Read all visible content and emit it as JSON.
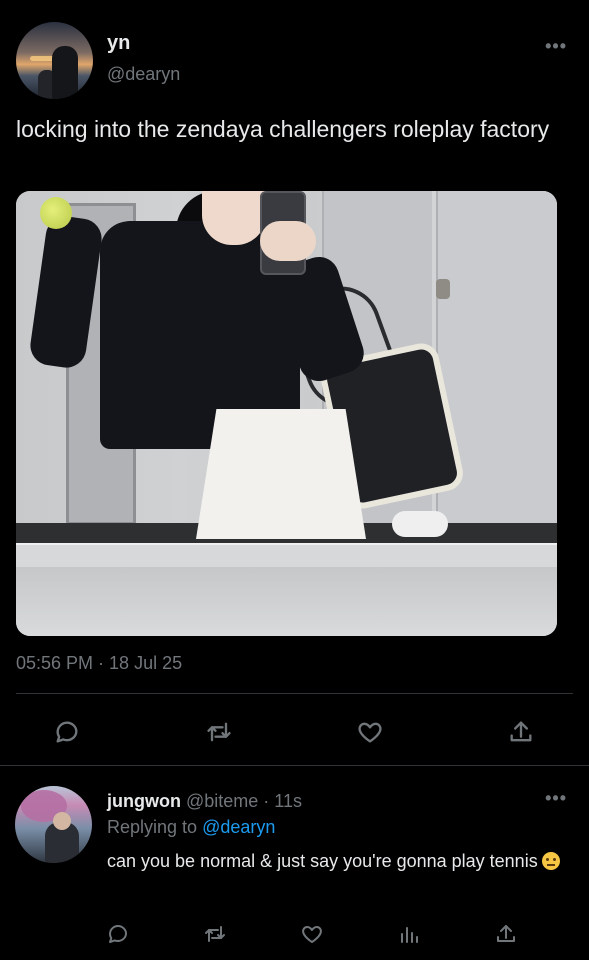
{
  "main_tweet": {
    "display_name": "yn",
    "handle": "@dearyn",
    "text": "locking into the zendaya challengers roleplay factory",
    "timestamp": "05:56 PM · 18 Jul 25",
    "more_icon": "more-horizontal-icon"
  },
  "actions": {
    "reply": "reply-icon",
    "retweet": "retweet-icon",
    "like": "heart-icon",
    "share": "share-icon"
  },
  "reply_tweet": {
    "display_name": "jungwon",
    "handle_time": "@biteme · 11s",
    "replying_prefix": "Replying to",
    "replying_to": "@dearyn",
    "text": "can you be normal & just say you're gonna play tennis",
    "emoji": "raised-eyebrow-face-emoji"
  },
  "colors": {
    "background": "#000000",
    "text": "#e7e9ea",
    "muted": "#71767b",
    "link": "#1d9bf0",
    "divider": "#2f3336"
  }
}
